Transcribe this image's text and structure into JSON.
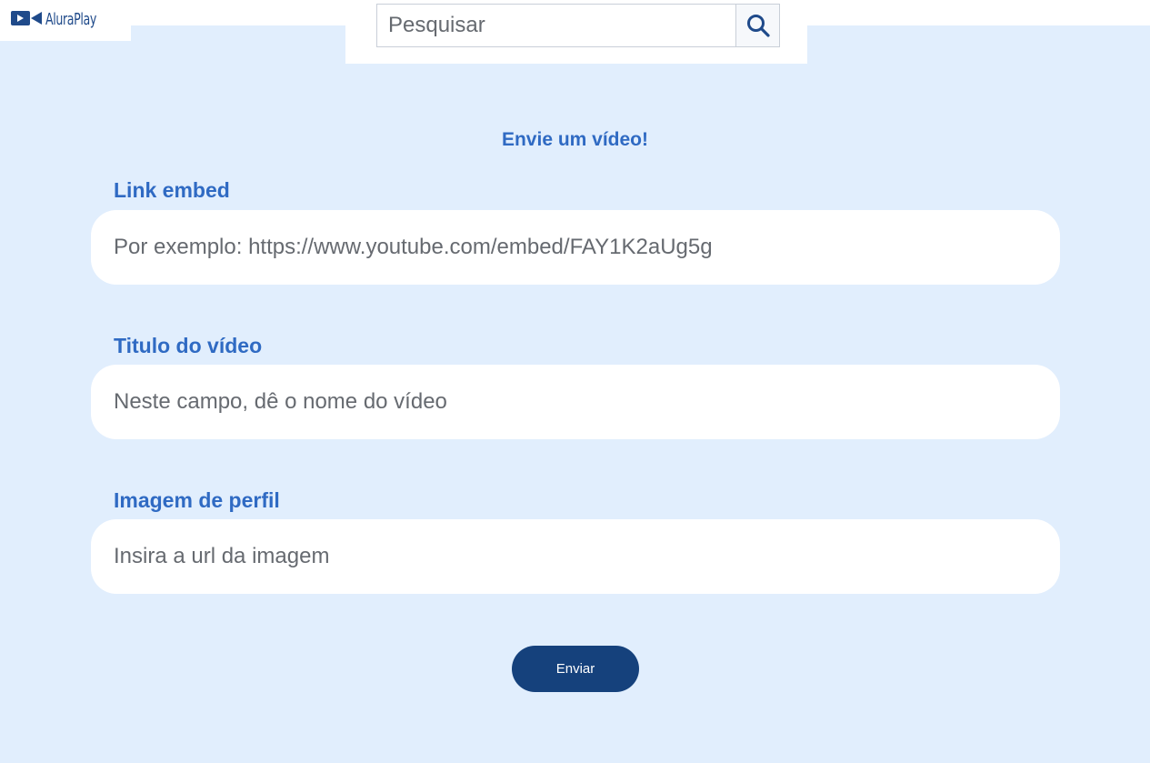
{
  "header": {
    "logo_text": "AluraPlay",
    "search": {
      "placeholder": "Pesquisar",
      "value": "",
      "icon": "search-icon"
    }
  },
  "form": {
    "title": "Envie um vídeo!",
    "fields": [
      {
        "label": "Link embed",
        "placeholder": "Por exemplo: https://www.youtube.com/embed/FAY1K2aUg5g",
        "value": ""
      },
      {
        "label": "Titulo do vídeo",
        "placeholder": "Neste campo, dê o nome do vídeo",
        "value": ""
      },
      {
        "label": "Imagem de perfil",
        "placeholder": "Insira a url da imagem",
        "value": ""
      }
    ],
    "submit_label": "Enviar"
  },
  "colors": {
    "background": "#e1eefd",
    "accent": "#2f6ac3",
    "button": "#15417c",
    "logo": "#1f4a8a"
  }
}
